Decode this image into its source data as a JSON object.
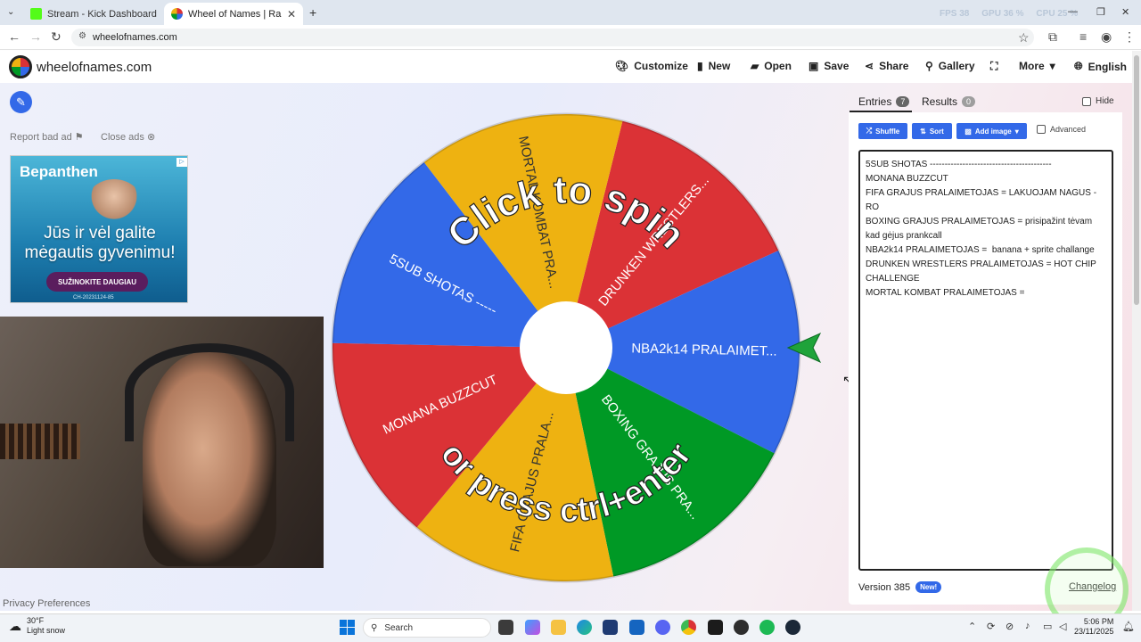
{
  "browser": {
    "tabs": [
      {
        "title": "Stream - Kick Dashboard",
        "active": false
      },
      {
        "title": "Wheel of Names | Random nam",
        "active": true
      }
    ],
    "new_tab": "+",
    "url": "wheelofnames.com",
    "stats": {
      "fps_label": "FPS",
      "fps": "38",
      "gpu_label": "GPU",
      "gpu": "36 %",
      "cpu_label": "CPU",
      "cpu": "25 %"
    }
  },
  "site": {
    "name": "wheelofnames.com",
    "menu": [
      "Customize",
      "New",
      "Open",
      "Save",
      "Share",
      "Gallery",
      "More",
      "English"
    ]
  },
  "ads": {
    "report": "Report bad ad",
    "close": "Close ads",
    "brand": "Bepanthen",
    "copy": "Jūs ir vėl galite mėgautis gyvenimu!",
    "cta": "SUŽINOKITE DAUGIAU",
    "code": "CH-20231124-85"
  },
  "wheel": {
    "spin_text_top": "Click to spin",
    "spin_text_bottom": "or press ctrl+enter",
    "colors": {
      "red": "#db3236",
      "blue": "#3369e8",
      "green": "#009925",
      "yellow": "#eeb211"
    },
    "segments": [
      {
        "label": "DRUNKEN WRESTLERS...",
        "color": "red"
      },
      {
        "label": "NBA2k14 PRALAIMET...",
        "color": "blue"
      },
      {
        "label": "BOXING GRAJUS PRA...",
        "color": "green"
      },
      {
        "label": "FIFA GRAJUS PRALA...",
        "color": "yellow"
      },
      {
        "label": "MONANA BUZZCUT",
        "color": "red"
      },
      {
        "label": "5SUB SHOTAS -----",
        "color": "blue"
      },
      {
        "label": "MORTAL KOMBAT PRA...",
        "color": "yellow"
      }
    ]
  },
  "panel": {
    "entries_label": "Entries",
    "entries_count": "7",
    "results_label": "Results",
    "results_count": "0",
    "hide_label": "Hide",
    "shuffle": "Shuffle",
    "sort": "Sort",
    "add_image": "Add image",
    "advanced": "Advanced",
    "entries_text": "5SUB SHOTAS -----------------------------------------\nMONANA BUZZCUT\nFIFA GRAJUS PRALAIMETOJAS = LAKUOJAM NAGUS - RO\nBOXING GRAJUS PRALAIMETOJAS = prisipažint tėvam kad gėjus prankcall\nNBA2k14 PRALAIMETOJAS =  banana + sprite challange\nDRUNKEN WRESTLERS PRALAIMETOJAS = HOT CHIP CHALLENGE\nMORTAL KOMBAT PRALAIMETOJAS =",
    "version": "Version 385",
    "new_badge": "New!",
    "changelog": "Changelog"
  },
  "footer": {
    "privacy": "Privacy Preferences"
  },
  "taskbar": {
    "temp": "30°F",
    "weather": "Light snow",
    "search": "Search",
    "time": "5:06 PM",
    "date": "23/11/2025"
  }
}
